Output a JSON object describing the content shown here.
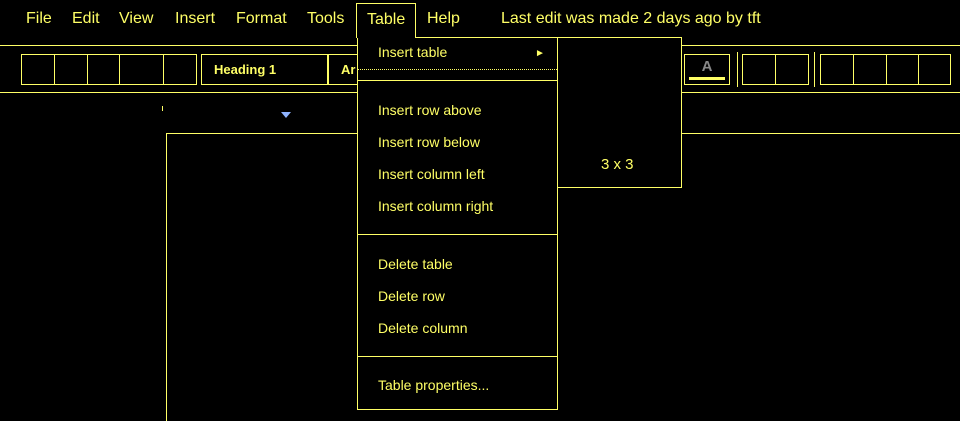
{
  "menubar": {
    "items": [
      {
        "label": "File"
      },
      {
        "label": "Edit"
      },
      {
        "label": "View"
      },
      {
        "label": "Insert"
      },
      {
        "label": "Format"
      },
      {
        "label": "Tools"
      },
      {
        "label": "Table"
      },
      {
        "label": "Help"
      }
    ],
    "active": "Table",
    "last_edit": "Last edit was made 2 days ago by tft"
  },
  "toolbar": {
    "paragraph_style": "Heading 1",
    "font_name": "Ar",
    "text_color_glyph": "A"
  },
  "table_menu": {
    "insert_table": "Insert table",
    "submenu_arrow": "►",
    "insert_row_above": "Insert row above",
    "insert_row_below": "Insert row below",
    "insert_column_left": "Insert column left",
    "insert_column_right": "Insert column right",
    "delete_table": "Delete table",
    "delete_row": "Delete row",
    "delete_column": "Delete column",
    "table_properties": "Table properties..."
  },
  "insert_table_submenu": {
    "grid_size": "3 x 3"
  },
  "colors": {
    "foreground": "#ffff66",
    "background": "#000000",
    "ruler_marker": "#8fb3ff",
    "disabled_glyph": "#888888"
  }
}
